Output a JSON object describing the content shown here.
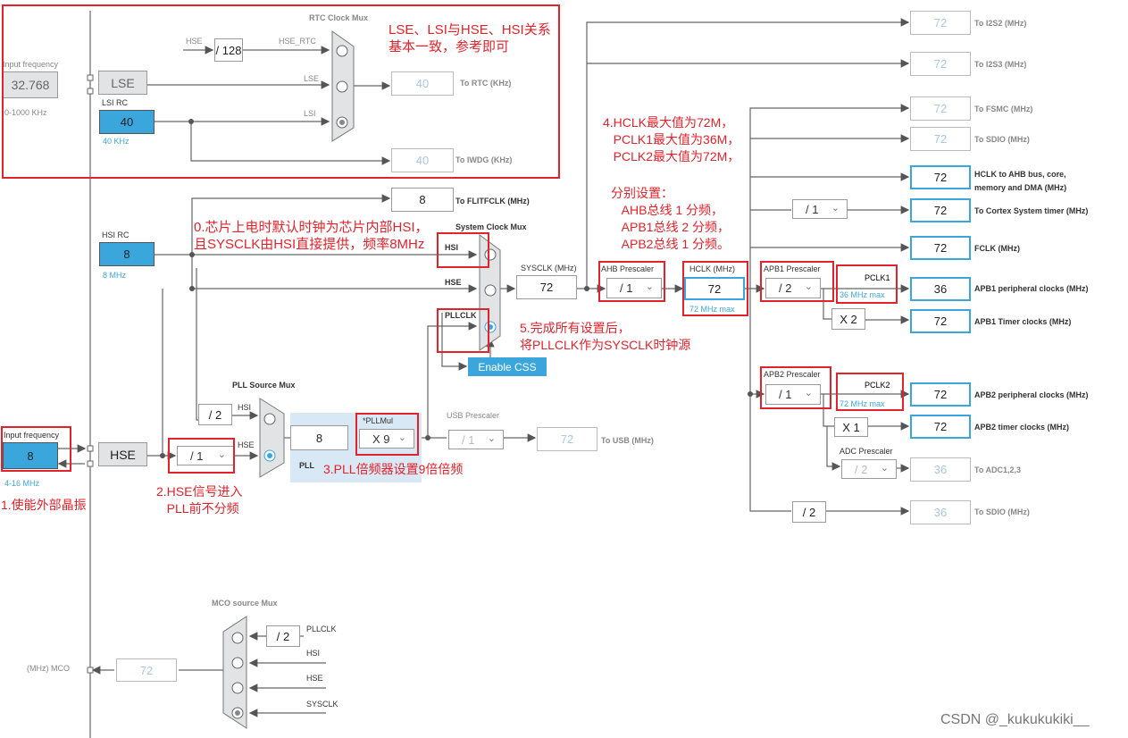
{
  "rtc": {
    "mux_title": "RTC Clock Mux",
    "hse": "HSE",
    "div128": "/ 128",
    "hse_rtc": "HSE_RTC",
    "lse": "LSE",
    "lsi": "LSI",
    "to_rtc_val": "40",
    "to_rtc": "To RTC (KHz)",
    "to_iwdg_val": "40",
    "to_iwdg": "To IWDG (KHz)"
  },
  "lse": {
    "input_label": "Input frequency",
    "input_val": "32.768",
    "range": "0-1000 KHz",
    "block": "LSE"
  },
  "lsi": {
    "title": "LSI RC",
    "val": "40",
    "unit": "40 KHz"
  },
  "hsi": {
    "title": "HSI RC",
    "val": "8",
    "unit": "8 MHz"
  },
  "flit": {
    "val": "8",
    "label": "To FLITFCLK (MHz)"
  },
  "sysmux": {
    "title": "System Clock Mux",
    "hsi": "HSI",
    "hse": "HSE",
    "pllclk": "PLLCLK",
    "enable_css": "Enable CSS"
  },
  "sysclk": {
    "label": "SYSCLK (MHz)",
    "val": "72"
  },
  "ahb": {
    "label": "AHB Prescaler",
    "val": "/ 1"
  },
  "hclk": {
    "label": "HCLK (MHz)",
    "val": "72",
    "max": "72 MHz max"
  },
  "apb1": {
    "label": "APB1 Prescaler",
    "val": "/ 2",
    "pclk": "PCLK1",
    "max": "36 MHz max",
    "x2": "X 2"
  },
  "apb2": {
    "label": "APB2 Prescaler",
    "val": "/ 1",
    "pclk": "PCLK2",
    "max": "72 MHz max",
    "x1": "X 1",
    "adc_label": "ADC Prescaler",
    "adc_val": "/ 2"
  },
  "outputs": [
    {
      "val": "72",
      "label": "To I2S2 (MHz)"
    },
    {
      "val": "72",
      "label": "To I2S3 (MHz)"
    },
    {
      "val": "72",
      "label": "To FSMC (MHz)"
    },
    {
      "val": "72",
      "label": "To SDIO (MHz)"
    },
    {
      "val": "72",
      "label": "HCLK to AHB bus, core,",
      "label2": "memory and DMA (MHz)"
    },
    {
      "val": "72",
      "label": "To Cortex System timer (MHz)",
      "div": "/ 1"
    },
    {
      "val": "72",
      "label": "FCLK (MHz)"
    },
    {
      "val": "36",
      "label": "APB1 peripheral clocks (MHz)"
    },
    {
      "val": "72",
      "label": "APB1 Timer clocks (MHz)"
    },
    {
      "val": "72",
      "label": "APB2 peripheral clocks (MHz)"
    },
    {
      "val": "72",
      "label": "APB2 timer clocks (MHz)"
    },
    {
      "val": "36",
      "label": "To ADC1,2,3"
    },
    {
      "val": "36",
      "label": "To SDIO (MHz)",
      "div": "/ 2"
    }
  ],
  "hse": {
    "input_label": "Input frequency",
    "input_val": "8",
    "range": "4-16 MHz",
    "block": "HSE",
    "div": "/ 1"
  },
  "pll": {
    "mux_title": "PLL Source Mux",
    "hsi_div": "/ 2",
    "hsi": "HSI",
    "hse": "HSE",
    "val": "8",
    "label": "PLL",
    "mul_label": "*PLLMul",
    "mul": "X 9"
  },
  "usb": {
    "label": "USB Prescaler",
    "div": "/ 1",
    "val": "72",
    "out": "To USB (MHz)"
  },
  "mco": {
    "title": "MCO source Mux",
    "div": "/ 2",
    "pllclk": "PLLCLK",
    "hsi": "HSI",
    "hse": "HSE",
    "sysclk": "SYSCLK",
    "val": "72",
    "label": "(MHz) MCO"
  },
  "notes": {
    "n_rtc": "LSE、LSI与HSE、HSI关系\n基本一致，参考即可",
    "n0": "0.芯片上电时默认时钟为芯片内部HSI，\n且SYSCLK由HSI直接提供，频率8MHz",
    "n1": "1.使能外部晶振",
    "n2": "2.HSE信号进入\n   PLL前不分频",
    "n3": "3.PLL倍频器设置9倍倍频",
    "n4": "4.HCLK最大值为72M，\n   PCLK1最大值为36M，\n   PCLK2最大值为72M，",
    "n4b": "分别设置：\n   AHB总线 1 分频，\n   APB1总线 2 分频，\n   APB2总线 1 分频。",
    "n5": "5.完成所有设置后，\n将PLLCLK作为SYSCLK时钟源"
  },
  "watermark": "CSDN @_kukukukiki__",
  "colors": {
    "accent": "#3aa6dc",
    "annotation": "#e3232b"
  }
}
